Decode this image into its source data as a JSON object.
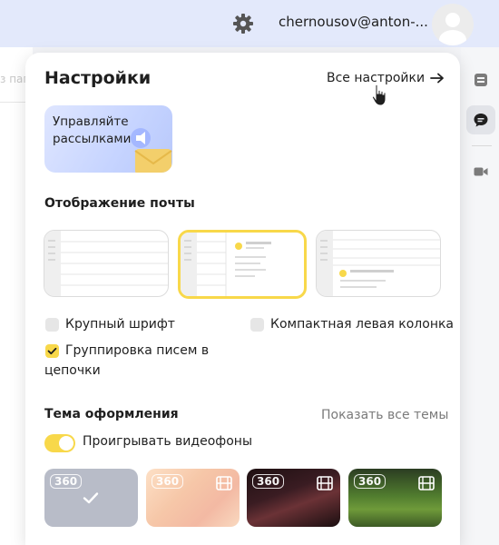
{
  "header": {
    "user_email": "chernousov@anton-..."
  },
  "background": {
    "left_fragment": "з пап"
  },
  "panel": {
    "title": "Настройки",
    "all_settings_label": "Все настройки",
    "promo_text": "Управляйте рассылками",
    "display_section": {
      "title": "Отображение почты",
      "layouts": [
        {
          "name": "list",
          "selected": false
        },
        {
          "name": "two-pane",
          "selected": true
        },
        {
          "name": "preview-below",
          "selected": false
        }
      ],
      "options": [
        {
          "label": "Крупный шрифт",
          "checked": false
        },
        {
          "label": "Компактная левая колонка",
          "checked": false
        },
        {
          "label_line1": "Группировка писем в",
          "label_line2": "цепочки",
          "checked": true
        }
      ]
    },
    "theme_section": {
      "title": "Тема оформления",
      "show_all_label": "Показать все темы",
      "video_toggle_label": "Проигрывать видеофоны",
      "video_toggle_on": true,
      "themes": [
        {
          "badge": "360",
          "selected": true,
          "video": false,
          "color": "#b8bcc8"
        },
        {
          "badge": "360",
          "selected": false,
          "video": true,
          "color": "#f6c7a8"
        },
        {
          "badge": "360",
          "selected": false,
          "video": true,
          "color": "#4a2528"
        },
        {
          "badge": "360",
          "selected": false,
          "video": true,
          "color": "#3f6a2a"
        }
      ]
    }
  },
  "colors": {
    "accent": "#f8d84a",
    "header_bg": "#e3e9fb"
  },
  "icons": [
    "gear-icon",
    "avatar-icon",
    "arrow-right-icon",
    "mail-icon",
    "chat-icon",
    "video-camera-icon",
    "checkmark-icon",
    "film-icon",
    "pointer-cursor-icon",
    "megaphone-icon"
  ]
}
